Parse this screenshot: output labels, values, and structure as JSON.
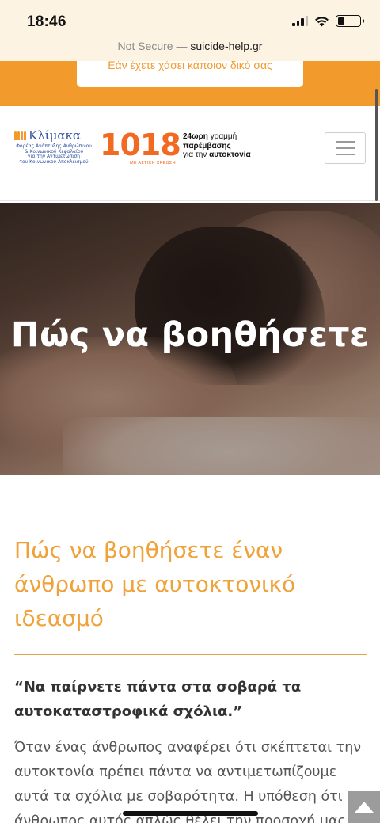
{
  "status_bar": {
    "time": "18:46",
    "battery_level": 0.3
  },
  "browser": {
    "security_label": "Not Secure",
    "separator": " — ",
    "domain": "suicide-help.gr"
  },
  "notice": {
    "label": "Εάν έχετε χάσει κάποιον δικό σας"
  },
  "header": {
    "logo_title": "Κλίμακα",
    "logo_tagline": [
      "Φορέας Ανάπτυξης Ανθρώπινου",
      "& Κοινωνικού Κεφαλαίου",
      "για την Αντιμετώπιση",
      "του Κοινωνικού Αποκλεισμού"
    ],
    "hotline_number": "1018",
    "hotline_number_sub": "ΜΕ ΑΣΤΙΚΗ ΧΡΕΩΣΗ",
    "helpline_line1_bold": "24ωρη",
    "helpline_line1_rest": " γραμμή",
    "helpline_line2": "παρέμβασης",
    "helpline_line3_prefix": "για την ",
    "helpline_line3_bold": "αυτοκτονία"
  },
  "hero": {
    "title": "Πώς να βοηθήσετε"
  },
  "article": {
    "heading": "Πώς να βοηθήσετε έναν άνθρωπο με αυτοκτονικό ιδεασμό",
    "quote_line1": "“Να παίρνετε πάντα στα σοβαρά τα",
    "quote_line2": "αυτοκαταστροφικά σχόλια.”",
    "body_lines": [
      "Όταν ένας άνθρωπος αναφέρει ότι σκέπτεται την",
      "αυτοκτονία πρέπει πάντα να αντιμετωπίζουμε",
      "αυτά τα σχόλια με σοβαρότητα. Η υπόθεση ότι ο",
      "άνθρωπος αυτός απλώς θέλει την προσοχή μας"
    ]
  },
  "colors": {
    "accent": "#f39a2c",
    "hotline": "#f26a22",
    "logo_blue": "#2d4f9e",
    "heading": "#f0a23a"
  }
}
